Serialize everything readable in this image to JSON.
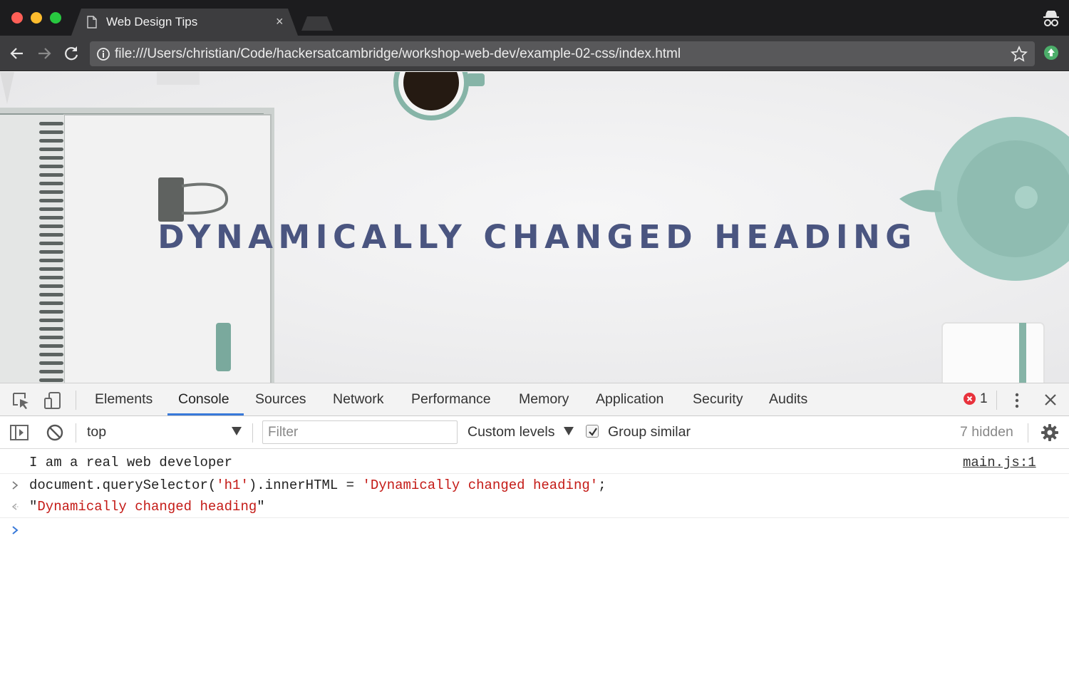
{
  "browser": {
    "tab_title": "Web Design Tips",
    "tab_close": "×",
    "url": "file:///Users/christian/Code/hackersatcambridge/workshop-web-dev/example-02-css/index.html"
  },
  "page": {
    "heading": "DYNAMICALLY CHANGED HEADING"
  },
  "devtools": {
    "tabs": [
      {
        "label": "Elements"
      },
      {
        "label": "Console",
        "active": true
      },
      {
        "label": "Sources"
      },
      {
        "label": "Network"
      },
      {
        "label": "Performance"
      },
      {
        "label": "Memory"
      },
      {
        "label": "Application"
      },
      {
        "label": "Security"
      },
      {
        "label": "Audits"
      }
    ],
    "error_count": "1",
    "close": "✕",
    "console_toolbar": {
      "context": "top",
      "filter_placeholder": "Filter",
      "levels": "Custom levels",
      "group_similar": "Group similar",
      "group_similar_checked": true,
      "hidden": "7 hidden"
    },
    "console": {
      "log_message": "I am a real web developer",
      "log_source": "main.js:1",
      "input_code_1": "document.querySelector(",
      "input_str_1": "'h1'",
      "input_code_2": ").innerHTML = ",
      "input_str_2": "'Dynamically changed heading'",
      "input_code_3": ";",
      "result_quote_open": "\"",
      "result_str": "Dynamically changed heading",
      "result_quote_close": "\""
    }
  },
  "colors": {
    "heading": "#4a5580",
    "active_tab_underline": "#3879d9",
    "string_red": "#c41a16",
    "error_red": "#e8323c",
    "prompt_blue": "#3879d9"
  }
}
